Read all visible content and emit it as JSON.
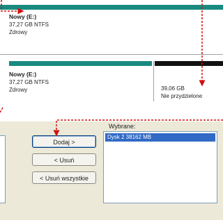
{
  "disk_map": {
    "upper_partition": {
      "name": "Nowy  (E:)",
      "size_fs": "37,27 GB NTFS",
      "status": "Zdrowy",
      "bar_color": "#1a8a80"
    },
    "lower_partition": {
      "name": "Nowy  (E:)",
      "size_fs": "37,27 GB NTFS",
      "status": "Zdrowy",
      "bar_color": "#1a8a80"
    },
    "unallocated": {
      "size": "39,06 GB",
      "status": "Nie przydzielone",
      "bar_color": "#111111"
    }
  },
  "dialog": {
    "selected_label": "Wybrane:",
    "selected_items": [
      "Dysk 2     38162 MB"
    ],
    "buttons": {
      "add": "Dodaj >",
      "remove": "< Usuń",
      "remove_all": "< Usuń wszystkie"
    }
  },
  "colors": {
    "annotation_arrow": "#d01010",
    "selection": "#316ac5"
  }
}
